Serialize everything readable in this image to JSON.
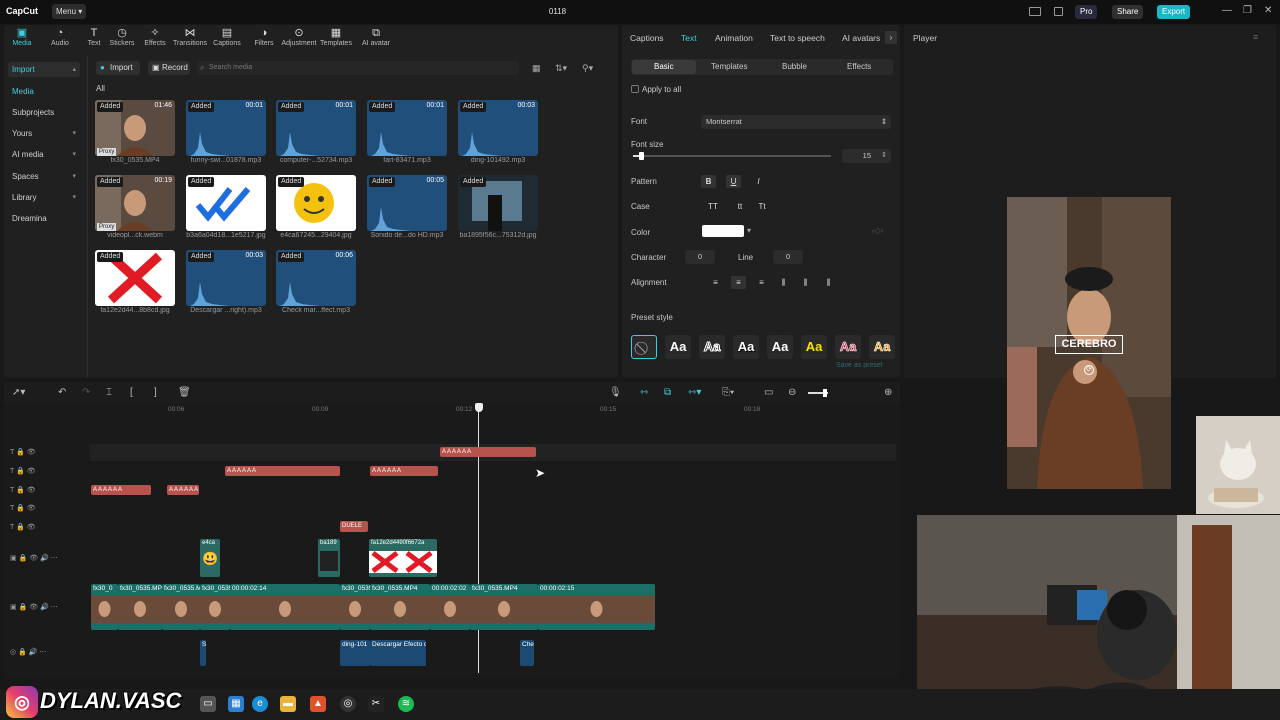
{
  "app": {
    "name": "CapCut",
    "menu": "Menu",
    "project_title": "0118",
    "pro": "Pro",
    "share": "Share",
    "export": "Export"
  },
  "tools": [
    {
      "label": "Media",
      "icon": "media-icon"
    },
    {
      "label": "Audio",
      "icon": "audio-icon"
    },
    {
      "label": "Text",
      "icon": "text-icon"
    },
    {
      "label": "Stickers",
      "icon": "stickers-icon"
    },
    {
      "label": "Effects",
      "icon": "effects-icon"
    },
    {
      "label": "Transitions",
      "icon": "transitions-icon"
    },
    {
      "label": "Captions",
      "icon": "captions-icon"
    },
    {
      "label": "Filters",
      "icon": "filters-icon"
    },
    {
      "label": "Adjustment",
      "icon": "adjustment-icon"
    },
    {
      "label": "Templates",
      "icon": "templates-icon"
    },
    {
      "label": "AI avatar",
      "icon": "ai-avatar-icon"
    }
  ],
  "sidebar": [
    "Import",
    "Media",
    "Subprojects",
    "Yours",
    "AI media",
    "Spaces",
    "Library",
    "Dreamina"
  ],
  "media": {
    "import": "Import",
    "record": "Record",
    "search_placeholder": "Search media",
    "all": "All",
    "added": "Added",
    "proxy": "Proxy",
    "items": [
      {
        "name": "fx30_0535.MP4",
        "dur": "01:46",
        "kind": "video"
      },
      {
        "name": "funny-swi...01878.mp3",
        "dur": "00:01",
        "kind": "audio"
      },
      {
        "name": "computer-...52734.mp3",
        "dur": "00:01",
        "kind": "audio"
      },
      {
        "name": "fart-83471.mp3",
        "dur": "00:01",
        "kind": "audio"
      },
      {
        "name": "ding-101492.mp3",
        "dur": "00:03",
        "kind": "audio"
      },
      {
        "name": "videopl...ck.webm",
        "dur": "00:19",
        "kind": "video"
      },
      {
        "name": "b3a6a04d18...1e5217.jpg",
        "dur": "",
        "kind": "check"
      },
      {
        "name": "e4ca67245...29404.jpg",
        "dur": "",
        "kind": "emoji"
      },
      {
        "name": "Sonido de...do HD.mp3",
        "dur": "00:05",
        "kind": "audio"
      },
      {
        "name": "ba1895f56c...75312d.jpg",
        "dur": "",
        "kind": "dark"
      },
      {
        "name": "fa12e2d44...8b8cd.jpg",
        "dur": "",
        "kind": "cross"
      },
      {
        "name": "Descargar ...right).mp3",
        "dur": "00:03",
        "kind": "audio"
      },
      {
        "name": "Check mar...ffect.mp3",
        "dur": "00:06",
        "kind": "audio"
      }
    ]
  },
  "props": {
    "tabs": [
      "Captions",
      "Text",
      "Animation",
      "Text to speech",
      "AI avatars"
    ],
    "subtabs": [
      "Basic",
      "Templates",
      "Bubble",
      "Effects"
    ],
    "apply_all": "Apply to all",
    "font_label": "Font",
    "font_value": "Montserrat",
    "size_label": "Font size",
    "size_value": "15",
    "size_fraction": 0.04,
    "pattern_label": "Pattern",
    "case_label": "Case",
    "case_opts": [
      "TT",
      "tt",
      "Tt"
    ],
    "color_label": "Color",
    "character_label": "Character",
    "character_value": "0",
    "line_label": "Line",
    "line_value": "0",
    "alignment_label": "Alignment",
    "preset_label": "Preset style",
    "save_preset": "Save as preset",
    "preset_glyph": "Aa",
    "text_color": "#ffffff",
    "accent": "#3ad0dd"
  },
  "player": {
    "label": "Player",
    "caption": "CEREBRO"
  },
  "timeline": {
    "ruler": [
      "00:06",
      "00:09",
      "00:12",
      "00:15",
      "00:18"
    ],
    "sticker_label": "DUELE",
    "image_clips": [
      "e4ca",
      "ba189",
      "fa12e2d4490f6672a"
    ],
    "video_clips": [
      "fx30_0",
      "fx30_0535.MP4",
      "fx30_0535.MP4",
      "fx30_0535.MP4",
      "00:00:02:14",
      "fx30_0535.MP4",
      "fx30_0535.MP4",
      "00:00:02:02",
      "fx30_0535.MP4",
      "00:00:02:15"
    ],
    "audio_clips": [
      "S",
      "ding-101",
      "Descargar Efecto d",
      "Chec"
    ]
  },
  "overlay": {
    "instagram": "DYLAN.VASC"
  }
}
